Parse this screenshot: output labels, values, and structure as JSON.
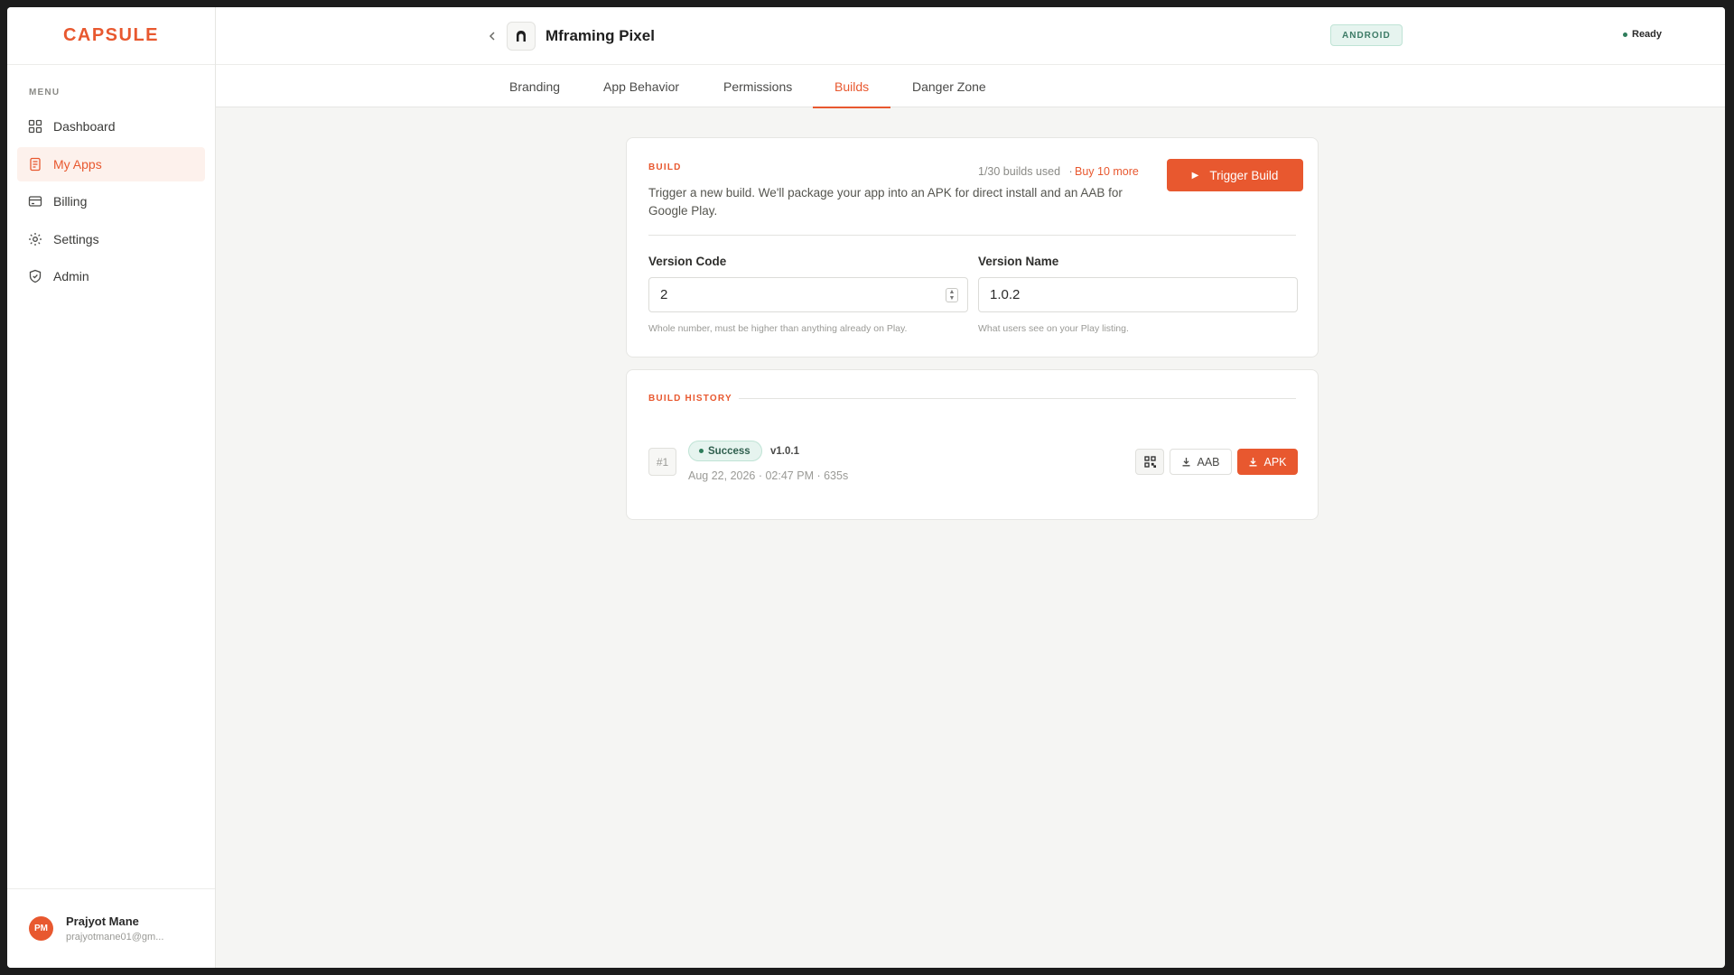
{
  "brand": "CAPSULE",
  "sidebar": {
    "menu_label": "MENU",
    "items": [
      {
        "label": "Dashboard",
        "icon": "grid-icon"
      },
      {
        "label": "My Apps",
        "icon": "document-icon",
        "active": true
      },
      {
        "label": "Billing",
        "icon": "card-icon"
      },
      {
        "label": "Settings",
        "icon": "gear-icon"
      },
      {
        "label": "Admin",
        "icon": "shield-icon"
      }
    ],
    "user": {
      "initials": "PM",
      "name": "Prajyot Mane",
      "email": "prajyotmane01@gm..."
    }
  },
  "header": {
    "app_name": "Mframing Pixel",
    "platform": "ANDROID",
    "status": "Ready"
  },
  "tabs": [
    {
      "label": "Branding"
    },
    {
      "label": "App Behavior"
    },
    {
      "label": "Permissions"
    },
    {
      "label": "Builds",
      "active": true
    },
    {
      "label": "Danger Zone"
    }
  ],
  "build": {
    "section_label": "BUILD",
    "description": "Trigger a new build. We'll package your app into an APK for direct install and an AAB for Google Play.",
    "usage": "1/30 builds used",
    "separator": "·",
    "buy_label": "Buy 10 more",
    "trigger_label": "Trigger Build",
    "version_code": {
      "label": "Version Code",
      "value": "2",
      "hint": "Whole number, must be higher than anything already on Play."
    },
    "version_name": {
      "label": "Version Name",
      "value": "1.0.2",
      "hint": "What users see on your Play listing."
    }
  },
  "history": {
    "section_label": "BUILD HISTORY",
    "builds": [
      {
        "number": "#1",
        "status": "Success",
        "version": "v1.0.1",
        "meta": "Aug 22, 2026 · 02:47 PM · 635s",
        "aab_label": "AAB",
        "apk_label": "APK"
      }
    ]
  },
  "colors": {
    "accent": "#e8582f",
    "success": "#2e7d5b",
    "background": "#f5f5f3"
  }
}
